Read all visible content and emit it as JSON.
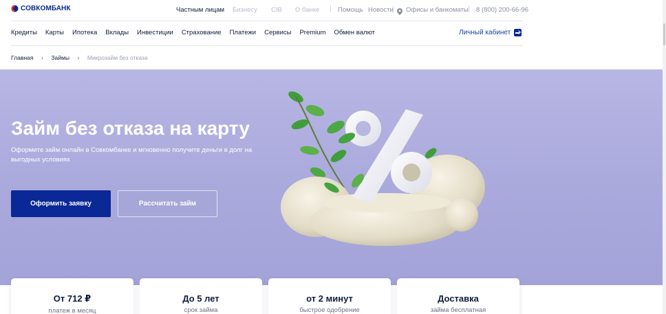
{
  "header": {
    "logo_text": "СОВКОМБАНК",
    "segments": [
      {
        "label": "Частным лицам",
        "active": true
      },
      {
        "label": "Бизнесу",
        "active": false
      },
      {
        "label": "CIB",
        "active": false
      },
      {
        "label": "О банке",
        "active": false
      }
    ],
    "help": "Помощь",
    "news": "Новости",
    "offices": "Офисы и банкоматы",
    "phone": "8 (800) 200-66-96"
  },
  "nav": {
    "items": [
      "Кредиты",
      "Карты",
      "Ипотека",
      "Вклады",
      "Инвестиции",
      "Страхование",
      "Платежи",
      "Сервисы",
      "Premium",
      "Обмен валют"
    ],
    "cabinet": "Личный кабинет"
  },
  "breadcrumb": [
    "Главная",
    "Займы",
    "Микрозайм без отказа"
  ],
  "hero": {
    "title": "Займ без отказа на карту",
    "subtitle": "Оформите займ онлайн в Совкомбанке и мгновенно получите деньги в долг на выгодных условиях",
    "primary_button": "Оформить заявку",
    "secondary_button": "Рассчитать займ"
  },
  "features": [
    {
      "title": "От 712 ₽",
      "subtitle": "платеж в месяц"
    },
    {
      "title": "До 5 лет",
      "subtitle": "срок займа"
    },
    {
      "title": "от 2 минут",
      "subtitle": "быстрое одобрение"
    },
    {
      "title": "Доставка",
      "subtitle": "займа бесплатная"
    }
  ],
  "colors": {
    "brand_blue": "#0a2896",
    "brand_red": "#e3342b",
    "hero_background": "#aaa9dc"
  },
  "icons": [
    "logo-icon",
    "location-pin-icon",
    "login-icon",
    "chevron-right-icon"
  ]
}
